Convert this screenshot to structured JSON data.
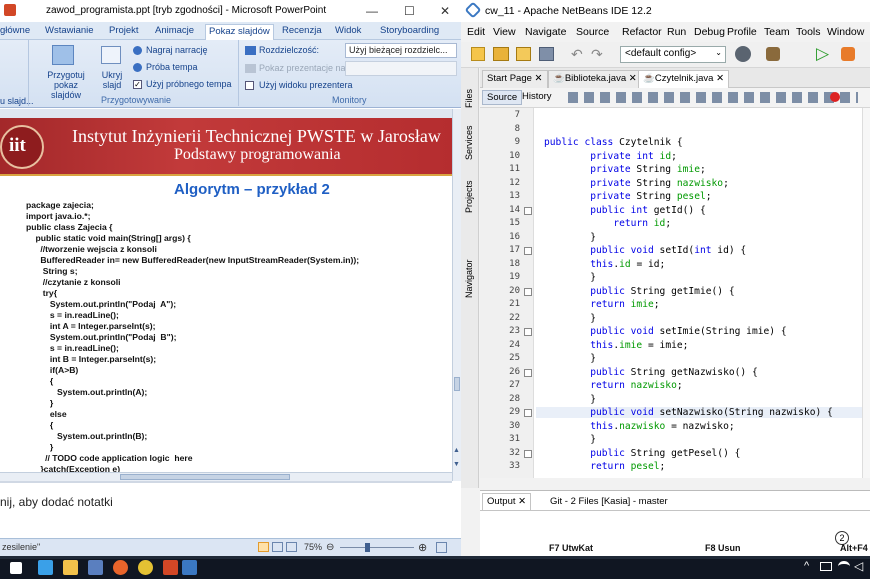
{
  "powerpoint": {
    "title": "zawod_programista.ppt [tryb zgodności] - Microsoft PowerPoint",
    "tabs": [
      "główne",
      "Wstawianie",
      "Projekt",
      "Animacje",
      "Pokaz slajdów",
      "Recenzja",
      "Widok",
      "Storyboarding"
    ],
    "active_tab": "Pokaz slajdów",
    "ribbon": {
      "rehearse_label": "Przygotuj pokaz slajdów",
      "hide_label": "Ukryj slajd",
      "record_narration": "Nagraj narrację",
      "rehearse_timings": "Próba tempa",
      "use_timings": "Użyj próbnego tempa",
      "resolution_label": "Rozdzielczość:",
      "resolution_value": "Użyj bieżącej rozdzielc...",
      "show_presentation_on": "Pokaz prezentacje na:",
      "presenter_view": "Użyj widoku prezentera",
      "group_setup": "Przygotowywanie",
      "group_monitors": "Monitory",
      "group_left_fragment": "u slajd..."
    },
    "slide": {
      "header_line1": "Instytut Inżynierii Technicznej PWSTE w Jarosław",
      "header_line2": "Podstawy programowania",
      "logo_text": "iit",
      "title": "Algorytm – przykład 2",
      "code": "package zajecia;\nimport java.io.*;\npublic class Zajecia {\n    public static void main(String[] args) {\n      //tworzenie wejscia z konsoli\n      BufferedReader in= new BufferedReader(new InputStreamReader(System.in));\n       String s;\n       //czytanie z konsoli\n       try{\n          System.out.println(\"Podaj  A\");\n          s = in.readLine();\n          int A = Integer.parseInt(s);\n          System.out.println(\"Podaj  B\");\n          s = in.readLine();\n          int B = Integer.parseInt(s);\n          if(A>B)\n          {\n             System.out.println(A);\n          }\n          else\n          {\n             System.out.println(B);\n          }\n        // TODO code application logic  here\n      }catch(Exception e)"
    },
    "notes_placeholder": "nij, aby dodać notatki",
    "status_left": "zesilenie\"",
    "zoom": "75%"
  },
  "netbeans": {
    "title": "cw_11 - Apache NetBeans IDE 12.2",
    "menu": [
      "Edit",
      "View",
      "Navigate",
      "Source",
      "Refactor",
      "Run",
      "Debug",
      "Profile",
      "Team",
      "Tools",
      "Window"
    ],
    "config": "<default config>",
    "side_panels": [
      "Files",
      "Services",
      "Projects",
      "Navigator"
    ],
    "tabs": [
      "Start Page",
      "Biblioteka.java",
      "Czytelnik.java"
    ],
    "active_tab": "Czytelnik.java",
    "source_tab": "Source",
    "history_tab": "History",
    "lines": [
      {
        "n": "7",
        "t": ""
      },
      {
        "n": "8",
        "t": ""
      },
      {
        "n": "9",
        "t": "public class Czytelnik {"
      },
      {
        "n": "10",
        "t": "        private int id;"
      },
      {
        "n": "11",
        "t": "        private String imie;"
      },
      {
        "n": "12",
        "t": "        private String nazwisko;"
      },
      {
        "n": "13",
        "t": "        private String pesel;"
      },
      {
        "n": "14",
        "t": "        public int getId() {"
      },
      {
        "n": "15",
        "t": "            return id;"
      },
      {
        "n": "16",
        "t": "        }"
      },
      {
        "n": "17",
        "t": "        public void setId(int id) {"
      },
      {
        "n": "18",
        "t": "        this.id = id;"
      },
      {
        "n": "19",
        "t": "        }"
      },
      {
        "n": "20",
        "t": "        public String getImie() {"
      },
      {
        "n": "21",
        "t": "        return imie;"
      },
      {
        "n": "22",
        "t": "        }"
      },
      {
        "n": "23",
        "t": "        public void setImie(String imie) {"
      },
      {
        "n": "24",
        "t": "        this.imie = imie;"
      },
      {
        "n": "25",
        "t": "        }"
      },
      {
        "n": "26",
        "t": "        public String getNazwisko() {"
      },
      {
        "n": "27",
        "t": "        return nazwisko;"
      },
      {
        "n": "28",
        "t": "        }"
      },
      {
        "n": "29",
        "t": "        public void setNazwisko(String nazwisko) {"
      },
      {
        "n": "30",
        "t": "        this.nazwisko = nazwisko;"
      },
      {
        "n": "31",
        "t": "        }"
      },
      {
        "n": "32",
        "t": "        public String getPesel() {"
      },
      {
        "n": "33",
        "t": "        return pesel;"
      }
    ],
    "output_tabs": [
      "Output",
      "Git - 2 Files [Kasia] - master"
    ],
    "status_badge": "2"
  },
  "taskbar": {
    "keys": [
      "F7 UtwKat",
      "F8 Usun",
      "Alt+F4"
    ]
  },
  "colors": {
    "slide_header": "#b52d2f",
    "slide_title": "#1f5fc4",
    "keyword": "#0000e6",
    "field": "#009900",
    "taskbar": "#101622"
  }
}
